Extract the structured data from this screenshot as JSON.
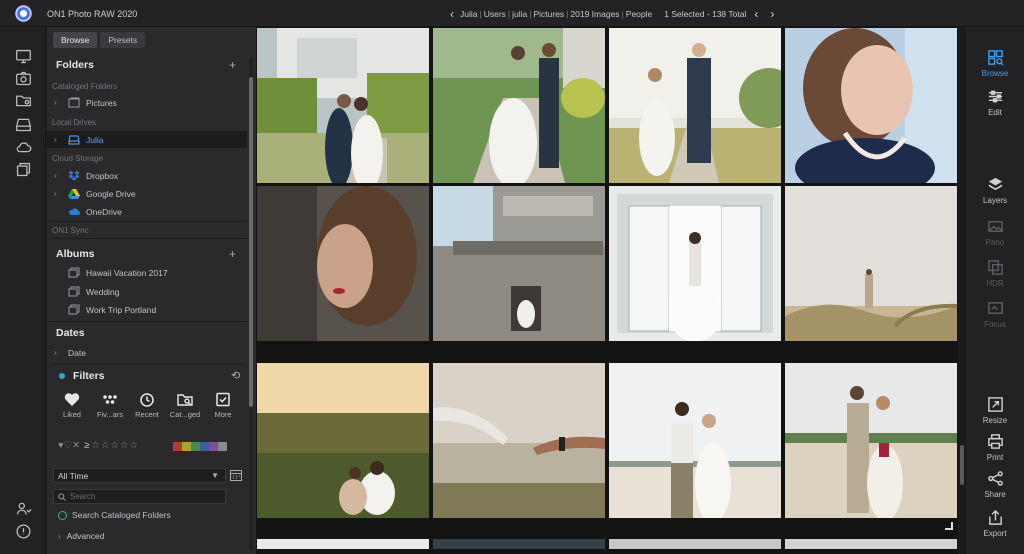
{
  "app": {
    "title": "ON1 Photo RAW 2020"
  },
  "breadcrumb": {
    "items": [
      "Julia",
      "Users",
      "julia",
      "Pictures",
      "2019 Images",
      "People"
    ],
    "count": "1 Selected - 138 Total"
  },
  "left_rail": {
    "icons": [
      "monitor-icon",
      "camera-icon",
      "folders-icon",
      "drive-icon",
      "cloud-icon",
      "albums-icon",
      "people-icon",
      "help-icon"
    ]
  },
  "panel": {
    "tabs": [
      {
        "label": "Browse",
        "active": true
      },
      {
        "label": "Presets",
        "active": false
      }
    ],
    "folders": {
      "title": "Folders",
      "cataloged_label": "Cataloged Folders",
      "cataloged": [
        "Pictures"
      ],
      "local_label": "Local Drives",
      "local": [
        "Julia"
      ],
      "cloud_label": "Cloud Storage",
      "cloud": [
        "Dropbox",
        "Google Drive",
        "OneDrive"
      ],
      "sync_label": "ON1 Sync"
    },
    "albums": {
      "title": "Albums",
      "items": [
        "Hawaii Vacation 2017",
        "Wedding",
        "Work Trip Portland"
      ]
    },
    "dates": {
      "title": "Dates",
      "items": [
        "Date"
      ]
    },
    "filters": {
      "title": "Filters",
      "buttons": [
        "Liked",
        "Fiv...ars",
        "Recent",
        "Cat...ged",
        "More"
      ],
      "rating": {
        "likes": "♥♡✕",
        "op": "≥",
        "stars": "☆☆☆☆☆"
      },
      "color_labels": [
        "#b33a3a",
        "#b0a03c",
        "#3f8f45",
        "#3a5fa3",
        "#7b4f9e",
        "#8a8a8a"
      ],
      "time_select": "All Time",
      "search_placeholder": "Search",
      "search_cataloged": "Search Cataloged Folders",
      "advanced": "Advanced"
    }
  },
  "modules": {
    "items": [
      {
        "label": "Browse",
        "icon": "browse-icon",
        "state": "active"
      },
      {
        "label": "Edit",
        "icon": "edit-sliders-icon",
        "state": "normal"
      },
      {
        "label": "Layers",
        "icon": "layers-icon",
        "state": "normal"
      },
      {
        "label": "Pano",
        "icon": "pano-icon",
        "state": "dim"
      },
      {
        "label": "HDR",
        "icon": "hdr-icon",
        "state": "dim"
      },
      {
        "label": "Focus",
        "icon": "focus-icon",
        "state": "dim"
      },
      {
        "label": "Resize",
        "icon": "resize-icon",
        "state": "normal"
      },
      {
        "label": "Print",
        "icon": "print-icon",
        "state": "normal"
      },
      {
        "label": "Share",
        "icon": "share-icon",
        "state": "normal"
      },
      {
        "label": "Export",
        "icon": "export-icon",
        "state": "normal"
      }
    ]
  },
  "grid": {
    "photos": [
      "couple-kissing-mansion-photo",
      "bride-groom-path-photo",
      "couple-walking-path-photo",
      "woman-portrait-pearls-photo",
      "woman-profile-moody-photo",
      "bride-balcony-building-photo",
      "bride-doorway-photo",
      "couple-dunes-photo",
      "couple-sunset-field-photo",
      "hands-reaching-photo",
      "couple-beach-suspenders-photo",
      "couple-beach-dunes-photo"
    ]
  }
}
